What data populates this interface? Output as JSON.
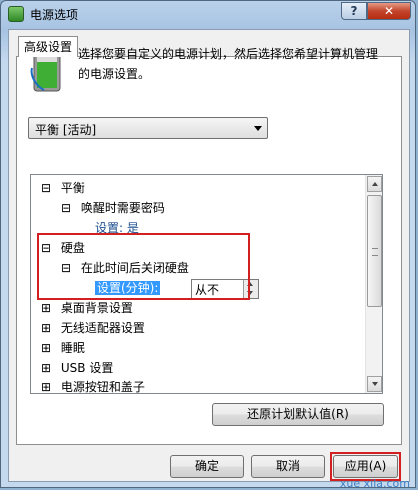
{
  "window": {
    "title": "电源选项",
    "help": "?",
    "close": "✕"
  },
  "tab": {
    "label": "高级设置"
  },
  "description": "选择您要自定义的电源计划，然后选择您希望计算机管理的电源设置。",
  "plan_dropdown": {
    "selected": "平衡 [活动]"
  },
  "tree": [
    {
      "expander": "⊟",
      "label": "平衡"
    },
    {
      "expander": "⊟",
      "label": "唤醒时需要密码"
    },
    {
      "label": "设置: 是"
    },
    {
      "expander": "⊟",
      "label": "硬盘"
    },
    {
      "expander": "⊟",
      "label": "在此时间后关闭硬盘"
    },
    {
      "label": "设置(分钟):",
      "value": "从不"
    },
    {
      "expander": "⊞",
      "label": "桌面背景设置"
    },
    {
      "expander": "⊞",
      "label": "无线适配器设置"
    },
    {
      "expander": "⊞",
      "label": "睡眠"
    },
    {
      "expander": "⊞",
      "label": "USB 设置"
    },
    {
      "expander": "⊞",
      "label": "电源按钮和盖子"
    }
  ],
  "buttons": {
    "restore": "还原计划默认值(R)",
    "ok": "确定",
    "cancel": "取消",
    "apply": "应用(A)"
  },
  "watermark": "xue xila.com"
}
